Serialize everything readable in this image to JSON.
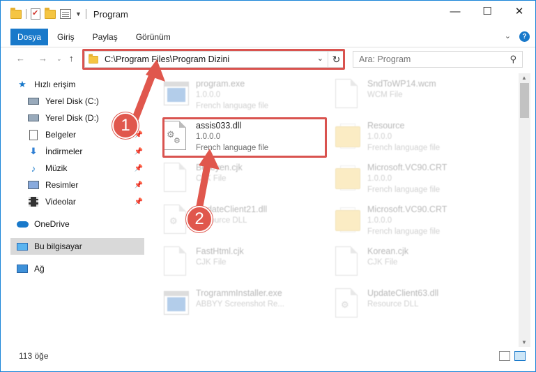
{
  "window": {
    "title": "Program",
    "controls": {
      "minimize": "—",
      "maximize": "☐",
      "close": "✕"
    }
  },
  "ribbon": {
    "tabs": [
      "Dosya",
      "Giriş",
      "Paylaş",
      "Görünüm"
    ],
    "expand": "⌄",
    "help": "?"
  },
  "address": {
    "path": "C:\\Program Files\\Program Dizini",
    "search_placeholder": "Ara: Program"
  },
  "sidebar": {
    "items": [
      {
        "label": "Hızlı erişim",
        "icon": "star-icon"
      },
      {
        "label": "Yerel Disk (C:)",
        "icon": "drive-icon"
      },
      {
        "label": "Yerel Disk (D:)",
        "icon": "drive-icon"
      },
      {
        "label": "Belgeler",
        "icon": "documents-icon",
        "pinned": true
      },
      {
        "label": "İndirmeler",
        "icon": "download-icon",
        "pinned": true
      },
      {
        "label": "Müzik",
        "icon": "music-icon",
        "pinned": true
      },
      {
        "label": "Resimler",
        "icon": "pictures-icon",
        "pinned": true
      },
      {
        "label": "Videolar",
        "icon": "videos-icon",
        "pinned": true
      },
      {
        "label": "OneDrive",
        "icon": "onedrive-icon"
      },
      {
        "label": "Bu bilgisayar",
        "icon": "this-pc-icon",
        "selected": true
      },
      {
        "label": "Ağ",
        "icon": "network-icon"
      }
    ]
  },
  "files": [
    {
      "name": "program.exe",
      "line2": "1.0.0.0",
      "line3": "French language file",
      "icon": "exe-icon",
      "faded": true
    },
    {
      "name": "SndToWP14.wcm",
      "line2": "WCM File",
      "line3": "",
      "icon": "document-icon",
      "faded": true
    },
    {
      "name": "assis033.dll",
      "line2": "1.0.0.0",
      "line3": "French language file",
      "icon": "dll-gear-icon",
      "faded": false
    },
    {
      "name": "Resource",
      "line2": "1.0.0.0",
      "line3": "French language file",
      "icon": "folder-icon",
      "faded": true
    },
    {
      "name": "Belleyen.cjk",
      "line2": "CJK File",
      "line3": "",
      "icon": "document-icon",
      "faded": true
    },
    {
      "name": "Microsoft.VC90.CRT",
      "line2": "1.0.0.0",
      "line3": "French language file",
      "icon": "folder-icon",
      "faded": true
    },
    {
      "name": "UpdateClient21.dll",
      "line2": "Resource DLL",
      "line3": "",
      "icon": "dll-gear-icon",
      "faded": true
    },
    {
      "name": "Microsoft.VC90.CRT",
      "line2": "1.0.0.0",
      "line3": "French language file",
      "icon": "folder-icon",
      "faded": true
    },
    {
      "name": "FastHtml.cjk",
      "line2": "CJK File",
      "line3": "",
      "icon": "document-icon",
      "faded": true
    },
    {
      "name": "Korean.cjk",
      "line2": "CJK File",
      "line3": "",
      "icon": "document-icon",
      "faded": true
    },
    {
      "name": "TrogrammInstaller.exe",
      "line2": "ABBYY Screenshot Re...",
      "line3": "",
      "icon": "exe-icon",
      "faded": true
    },
    {
      "name": "UpdateClient63.dll",
      "line2": "Resource DLL",
      "line3": "",
      "icon": "dll-gear-icon",
      "faded": true
    }
  ],
  "status": {
    "count": "113 öğe"
  },
  "annotations": {
    "step1": "1",
    "step2": "2",
    "color": "#e0574d"
  }
}
